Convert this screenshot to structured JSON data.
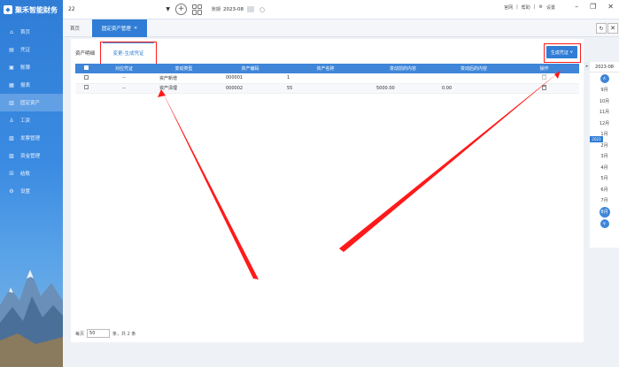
{
  "sidebar": {
    "logo_text": "聚禾智能财务",
    "items": [
      {
        "icon": "home-icon",
        "label": "首页"
      },
      {
        "icon": "voucher-icon",
        "label": "凭证"
      },
      {
        "icon": "account-book-icon",
        "label": "账簿"
      },
      {
        "icon": "report-icon",
        "label": "报表"
      },
      {
        "icon": "fixed-asset-icon",
        "label": "固定资产"
      },
      {
        "icon": "salary-icon",
        "label": "工资"
      },
      {
        "icon": "invoice-icon",
        "label": "发票管理"
      },
      {
        "icon": "cash-icon",
        "label": "资金管理"
      },
      {
        "icon": "period-end-icon",
        "label": "结账"
      },
      {
        "icon": "settings-icon",
        "label": "设置"
      }
    ]
  },
  "topbar": {
    "company": "22",
    "period_label": "账期",
    "period_value": "2023-08",
    "links": [
      "官网",
      "帮助",
      "设置"
    ]
  },
  "tabs": {
    "home": "首页",
    "active": "固定资产管理"
  },
  "panel": {
    "subtitle": "资产明细",
    "subtab": "变更-生成凭证",
    "generate_button": "生成凭证"
  },
  "table": {
    "headers": [
      "",
      "对应凭证",
      "变动类型",
      "资产编码",
      "资产名称",
      "变动前的内容",
      "变动后的内容",
      "操作"
    ],
    "rows": [
      {
        "voucher": "--",
        "type": "资产新增",
        "code": "000001",
        "name": "1",
        "before": "",
        "after": ""
      },
      {
        "voucher": "--",
        "type": "资产清理",
        "code": "000002",
        "name": "55",
        "before": "5000.00",
        "after": "0.00"
      }
    ]
  },
  "pager": {
    "prefix": "每页",
    "page_size": "50",
    "suffix": "条，共 2 条"
  },
  "rail": {
    "year": "2023-08",
    "year_tag": "2023",
    "months": [
      "9月",
      "10月",
      "11月",
      "12月",
      "1月",
      "2月",
      "3月",
      "4月",
      "5月",
      "6月",
      "7月",
      "8月"
    ],
    "selected_month": "8月"
  },
  "colors": {
    "primary": "#2f7dd6",
    "header": "#3f86d9",
    "highlight": "#ff1a1a"
  }
}
